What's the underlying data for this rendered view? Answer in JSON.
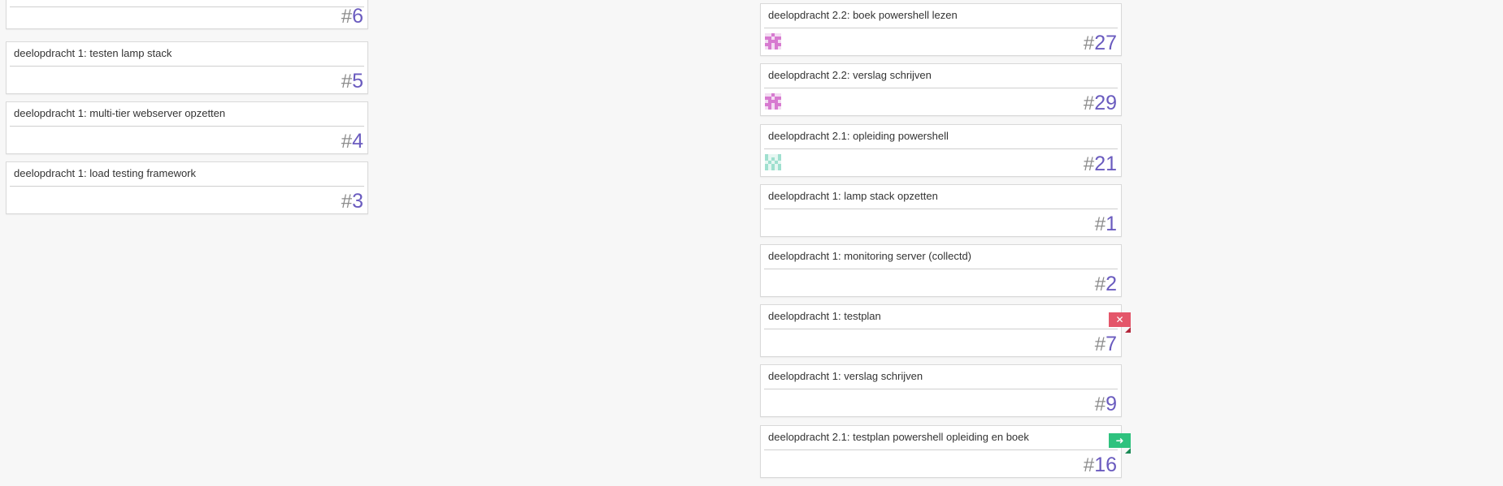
{
  "left_column": {
    "cards": [
      {
        "title": "deelopdracht 1: testen lamp stack",
        "number": "5"
      },
      {
        "title": "deelopdracht 1: multi-tier webserver opzetten",
        "number": "4"
      },
      {
        "title": "deelopdracht 1: load testing framework",
        "number": "3"
      }
    ],
    "partial_card": {
      "title": "",
      "number": "6"
    }
  },
  "right_column": {
    "cards": [
      {
        "title": "deelopdracht 2.2: boek powershell lezen",
        "number": "27",
        "avatar": "pink-identicon"
      },
      {
        "title": "deelopdracht 2.2: verslag schrijven",
        "number": "29",
        "avatar": "pink-identicon"
      },
      {
        "title": "deelopdracht 2.1: opleiding powershell",
        "number": "21",
        "avatar": "teal-identicon"
      },
      {
        "title": "deelopdracht 1: lamp stack opzetten",
        "number": "1"
      },
      {
        "title": "deelopdracht 1: monitoring server (collectd)",
        "number": "2"
      },
      {
        "title": "deelopdracht 1: testplan",
        "number": "7",
        "badge": {
          "glyph": "✕",
          "color": "#e4566a",
          "icon": "close-icon"
        }
      },
      {
        "title": "deelopdracht 1: verslag schrijven",
        "number": "9"
      },
      {
        "title": "deelopdracht 2.1: testplan powershell opleiding en boek",
        "number": "16",
        "badge": {
          "glyph": "➜",
          "color": "#2ec27e",
          "icon": "arrow-right-icon"
        }
      }
    ]
  },
  "hash_symbol": "#",
  "colors": {
    "number": "#6a5bbf",
    "hash": "#8c8c8c",
    "avatar_pink": "#d77ad0",
    "avatar_teal": "#9fe0cf"
  }
}
